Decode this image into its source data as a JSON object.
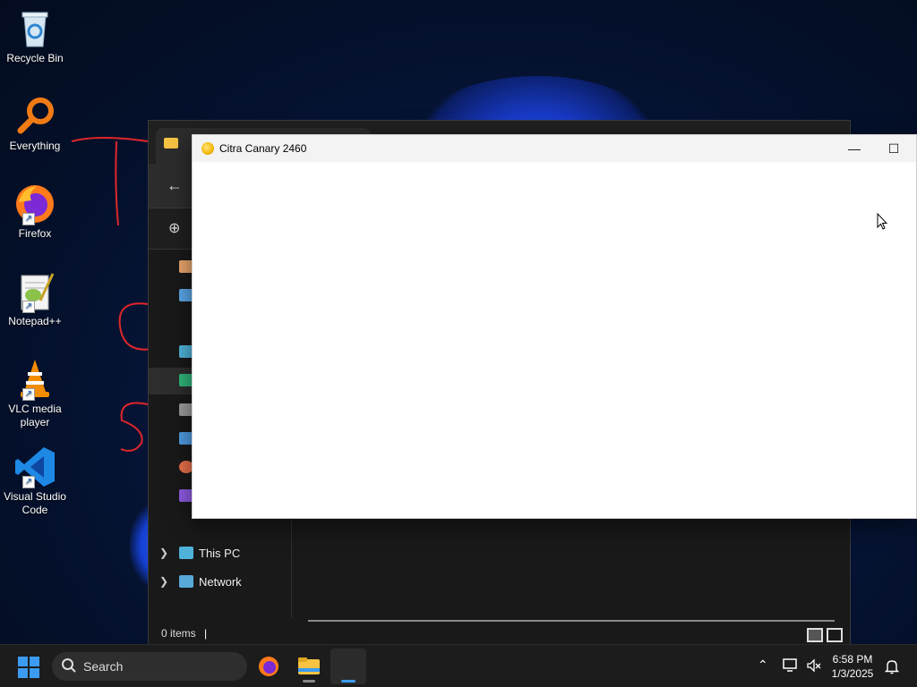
{
  "desktop": {
    "icons": [
      {
        "label": "Recycle Bin",
        "icon": "recycle-bin-icon"
      },
      {
        "label": "Everything",
        "icon": "everything-search-icon"
      },
      {
        "label": "Firefox",
        "icon": "firefox-icon"
      },
      {
        "label": "Notepad++",
        "icon": "notepad-plus-plus-icon"
      },
      {
        "label": "VLC media player",
        "icon": "vlc-icon"
      },
      {
        "label": "Visual Studio Code",
        "icon": "vscode-icon"
      }
    ]
  },
  "explorer": {
    "nav": {
      "this_pc": "This PC",
      "network": "Network"
    },
    "status": "0 items"
  },
  "citra": {
    "title": "Citra Canary 2460",
    "minimize": "—",
    "maximize": "☐"
  },
  "taskbar": {
    "search_label": "Search",
    "time": "6:58 PM",
    "date": "1/3/2025"
  },
  "colors": {
    "accent": "#3b9bf2",
    "scribble": "#e0262b"
  }
}
